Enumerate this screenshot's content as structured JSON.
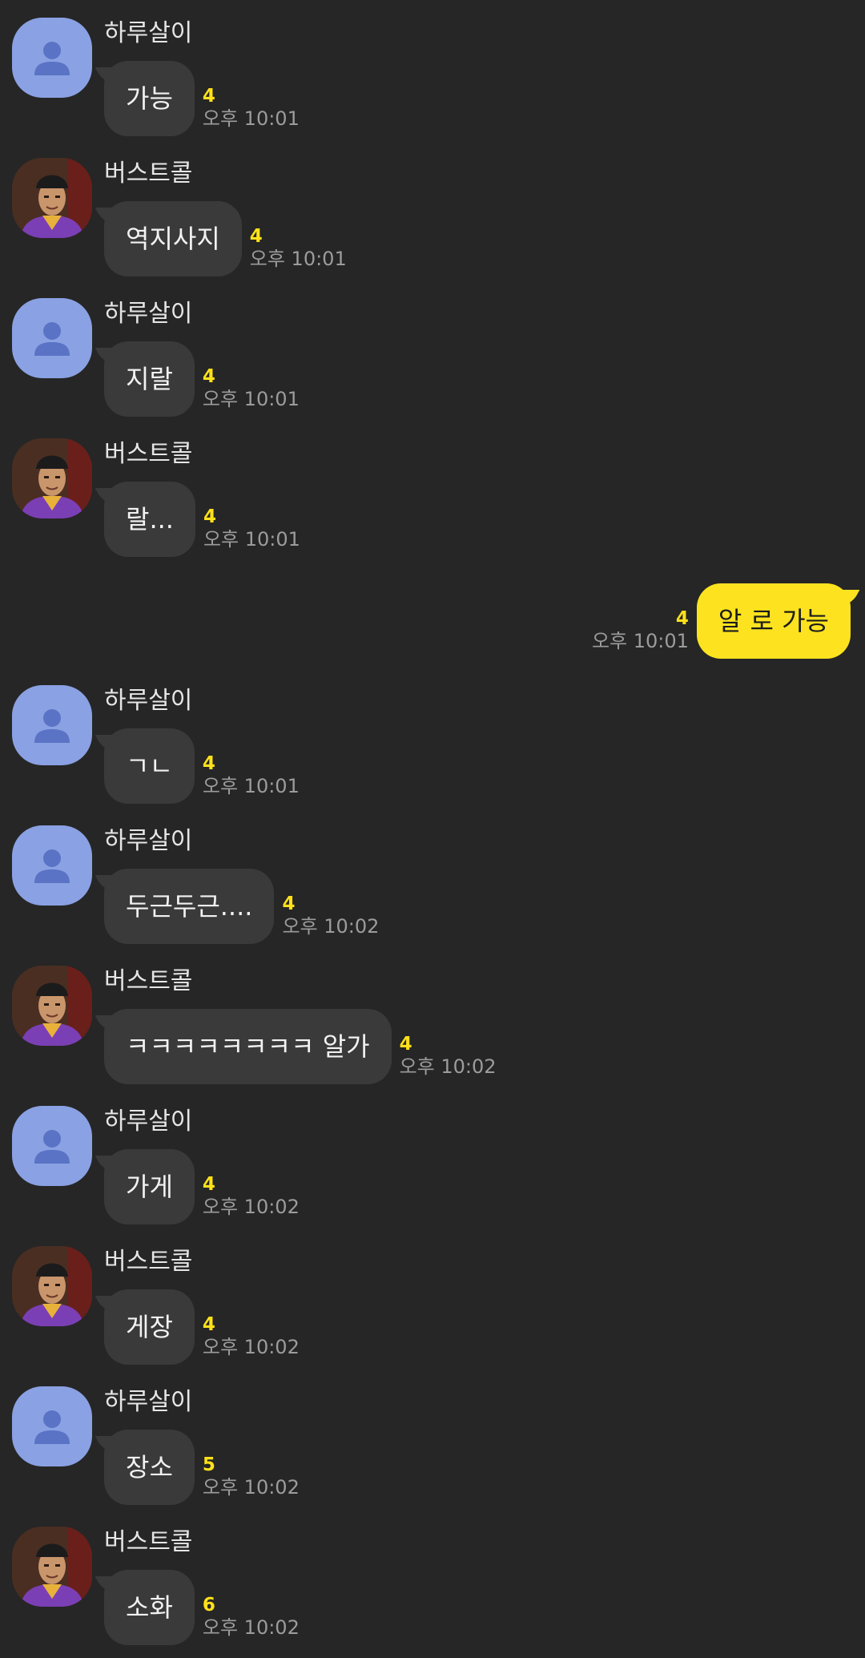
{
  "colors": {
    "background": "#262626",
    "incoming_bubble": "#3a3a3a",
    "outgoing_bubble": "#fde31f",
    "unread_count": "#ffe11a",
    "default_avatar": "#8aa1e3"
  },
  "messages": [
    {
      "sender": "하루살이",
      "avatar": "default-person-icon",
      "text": "가능",
      "unread": "4",
      "time": "오후 10:01",
      "outgoing": false
    },
    {
      "sender": "버스트콜",
      "avatar": "profile-photo",
      "text": "역지사지",
      "unread": "4",
      "time": "오후 10:01",
      "outgoing": false
    },
    {
      "sender": "하루살이",
      "avatar": "default-person-icon",
      "text": "지랄",
      "unread": "4",
      "time": "오후 10:01",
      "outgoing": false
    },
    {
      "sender": "버스트콜",
      "avatar": "profile-photo",
      "text": "랄...",
      "unread": "4",
      "time": "오후 10:01",
      "outgoing": false
    },
    {
      "sender": "",
      "avatar": "",
      "text": "알 로 가능",
      "unread": "4",
      "time": "오후 10:01",
      "outgoing": true
    },
    {
      "sender": "하루살이",
      "avatar": "default-person-icon",
      "text": "ㄱㄴ",
      "unread": "4",
      "time": "오후 10:01",
      "outgoing": false
    },
    {
      "sender": "하루살이",
      "avatar": "default-person-icon",
      "text": "두근두근....",
      "unread": "4",
      "time": "오후 10:02",
      "outgoing": false
    },
    {
      "sender": "버스트콜",
      "avatar": "profile-photo",
      "text": "ㅋㅋㅋㅋㅋㅋㅋㅋ 알가",
      "unread": "4",
      "time": "오후 10:02",
      "outgoing": false
    },
    {
      "sender": "하루살이",
      "avatar": "default-person-icon",
      "text": "가게",
      "unread": "4",
      "time": "오후 10:02",
      "outgoing": false
    },
    {
      "sender": "버스트콜",
      "avatar": "profile-photo",
      "text": "게장",
      "unread": "4",
      "time": "오후 10:02",
      "outgoing": false
    },
    {
      "sender": "하루살이",
      "avatar": "default-person-icon",
      "text": "장소",
      "unread": "5",
      "time": "오후 10:02",
      "outgoing": false
    },
    {
      "sender": "버스트콜",
      "avatar": "profile-photo",
      "text": "소화",
      "unread": "6",
      "time": "오후 10:02",
      "outgoing": false
    }
  ]
}
